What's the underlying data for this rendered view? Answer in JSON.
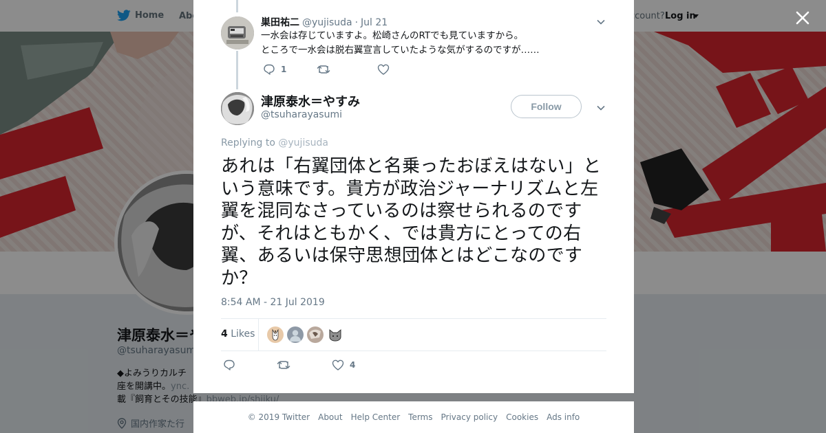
{
  "nav": {
    "home": "Home",
    "about": "Abo",
    "account_prompt": "ccount?",
    "login": "Log in"
  },
  "profile": {
    "name": "津原泰水＝や",
    "handle": "@tsuharayasumi",
    "bio_line1": "◆よみうりカルチ",
    "bio_line2": "座を開講中。",
    "bio_line2_link": "ync.",
    "bio_line3": "載『飼育とその技能』",
    "bio_line3_link": "bbweb.jp/shiiku/",
    "location": "国内作家た行"
  },
  "parent_tweet": {
    "name": "巣田祐二",
    "handle": "@yujisuda",
    "separator": "·",
    "date": "Jul 21",
    "text_line1": "一水会は存じていますよ。松崎さんのRTでも見ていますから。",
    "text_line2": "ところで一水会は脱右翼宣言していたような気がするのですが……",
    "reply_count": "1",
    "retweet_count": "",
    "like_count": ""
  },
  "tweet": {
    "name": "津原泰水＝やすみ",
    "handle": "@tsuharayasumi",
    "follow_label": "Follow",
    "replying_prefix": "Replying to",
    "replying_to": "@yujisuda",
    "text": "あれは「右翼団体と名乗ったおぼえはない」という意味です。貴方が政治ジャーナリズムと左翼を混同なさっているのは察せられるのですが、それはともかく、では貴方にとっての右翼、あるいは保守思想団体とはどこなのですか？",
    "timestamp": "8:54 AM - 21 Jul 2019",
    "likes_count": "4",
    "likes_label": "Likes",
    "like_action_count": "4"
  },
  "footer": {
    "copyright": "© 2019 Twitter",
    "links": [
      "About",
      "Help Center",
      "Terms",
      "Privacy policy",
      "Cookies",
      "Ads info"
    ]
  },
  "colors": {
    "brand": "#1da1f2",
    "muted": "#657786",
    "banner_red": "#d9252f"
  },
  "icons": {
    "close": "close-icon",
    "twitter": "twitter-bird-icon",
    "reply": "reply-icon",
    "retweet": "retweet-icon",
    "like": "heart-icon",
    "caret": "chevron-down-icon",
    "location": "location-pin-icon"
  }
}
